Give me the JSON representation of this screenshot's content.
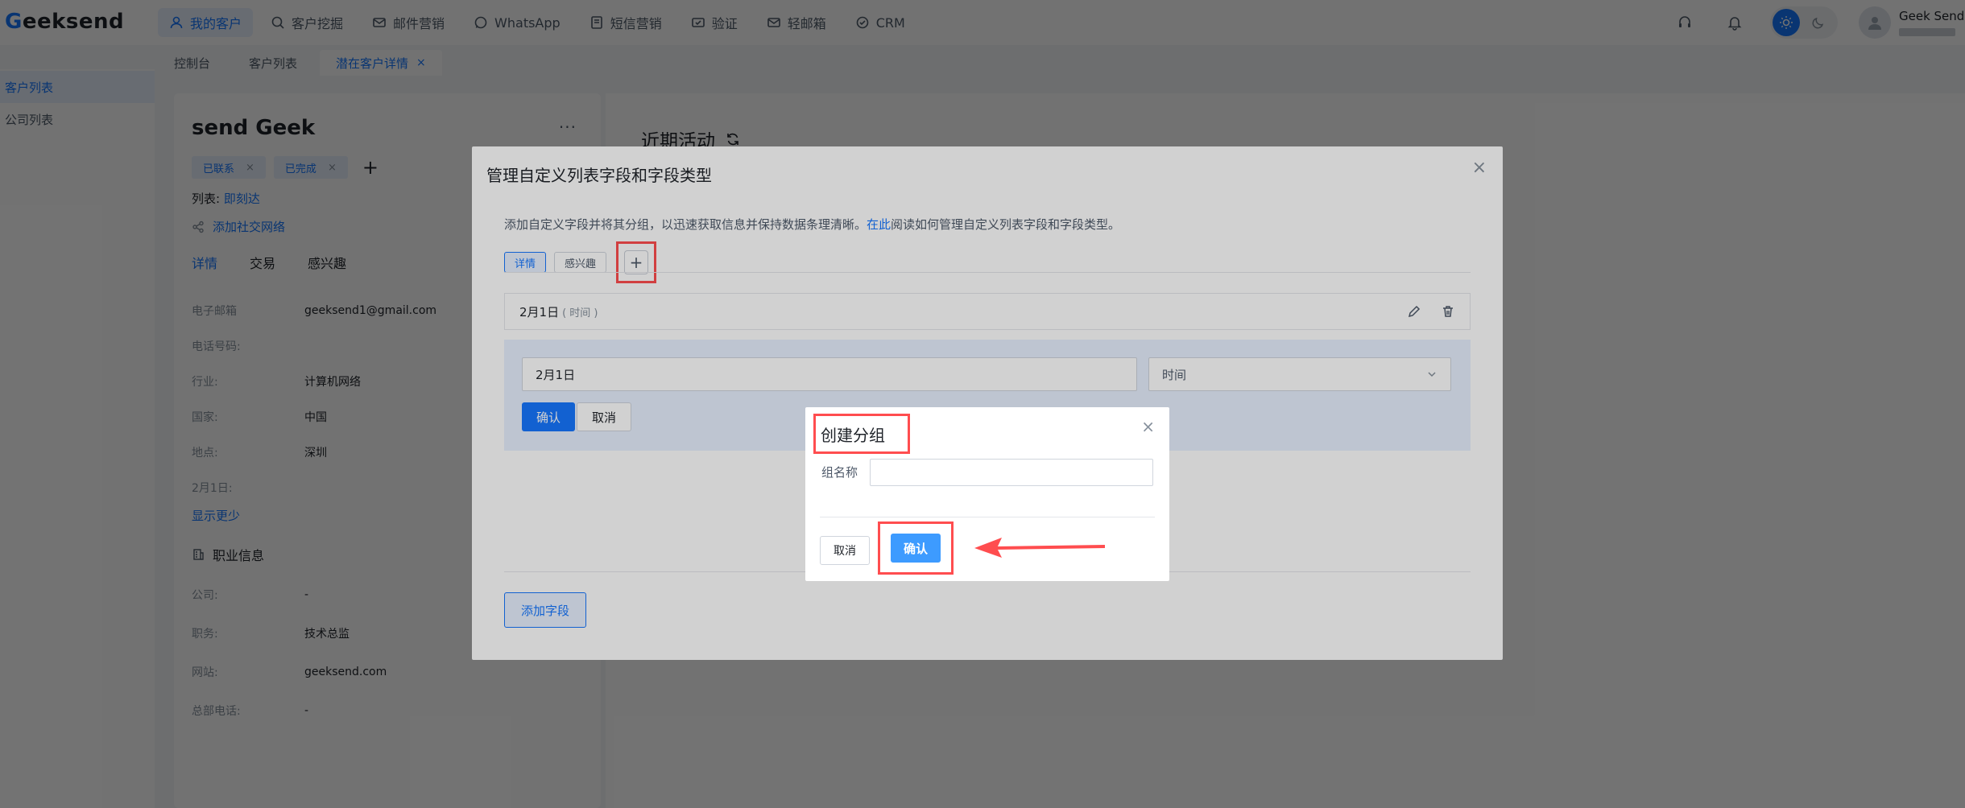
{
  "brand": {
    "logo_prefix": "G",
    "logo_rest": "eeksend"
  },
  "nav": [
    {
      "label": "我的客户",
      "icon": "user-icon"
    },
    {
      "label": "客户挖掘",
      "icon": "search-icon"
    },
    {
      "label": "邮件营销",
      "icon": "mail-icon"
    },
    {
      "label": "WhatsApp",
      "icon": "whatsapp-icon"
    },
    {
      "label": "短信营销",
      "icon": "sms-icon"
    },
    {
      "label": "验证",
      "icon": "verify-icon"
    },
    {
      "label": "轻邮箱",
      "icon": "mailbox-icon"
    },
    {
      "label": "CRM",
      "icon": "crm-icon"
    }
  ],
  "user": {
    "name": "Geek Send"
  },
  "tabs": [
    {
      "label": "控制台"
    },
    {
      "label": "客户列表"
    },
    {
      "label": "潜在客户详情",
      "close": "×"
    }
  ],
  "sidebar": [
    {
      "label": "客户列表"
    },
    {
      "label": "公司列表"
    }
  ],
  "contact": {
    "name": "send Geek",
    "more": "···",
    "tags": [
      {
        "label": "已联系",
        "close": "×"
      },
      {
        "label": "已完成",
        "close": "×"
      }
    ],
    "tag_add": "+",
    "list_label": "列表:",
    "list_value": "即刻达",
    "social_link": "添加社交网络",
    "detail_tabs": [
      "详情",
      "交易",
      "感兴趣"
    ],
    "fields": [
      {
        "label": "电子邮箱",
        "value": "geeksend1@gmail.com"
      },
      {
        "label": "电话号码:",
        "value": ""
      },
      {
        "label": "行业:",
        "value": "计算机网络"
      },
      {
        "label": "国家:",
        "value": "中国"
      },
      {
        "label": "地点:",
        "value": "深圳"
      },
      {
        "label": "2月1日:",
        "value": ""
      }
    ],
    "show_less": "显示更少",
    "job_section": "职业信息",
    "job_fields": [
      {
        "label": "公司:",
        "value": "-"
      },
      {
        "label": "职务:",
        "value": "技术总监"
      },
      {
        "label": "网站:",
        "value": "geeksend.com"
      },
      {
        "label": "总部电话:",
        "value": "-"
      }
    ]
  },
  "activity": {
    "title": "近期活动"
  },
  "modal": {
    "title": "管理自定义列表字段和字段类型",
    "close": "×",
    "desc_before": "添加自定义字段并将其分组，以迅速获取信息并保持数据条理清晰。",
    "desc_link": "在此",
    "desc_after": "阅读如何管理自定义列表字段和字段类型。",
    "groups": [
      "详情",
      "感兴趣"
    ],
    "group_add": "+",
    "field_row": {
      "name": "2月1日",
      "type": "( 时间 )"
    },
    "edit": {
      "name_value": "2月1日",
      "type_value": "时间",
      "confirm": "确认",
      "cancel": "取消"
    },
    "add_field": "添加字段"
  },
  "dialog": {
    "title": "创建分组",
    "close": "×",
    "label": "组名称",
    "input_value": "",
    "cancel": "取消",
    "confirm": "确认"
  },
  "colors": {
    "accent": "#1677ff",
    "highlight": "#ff4d4f"
  }
}
